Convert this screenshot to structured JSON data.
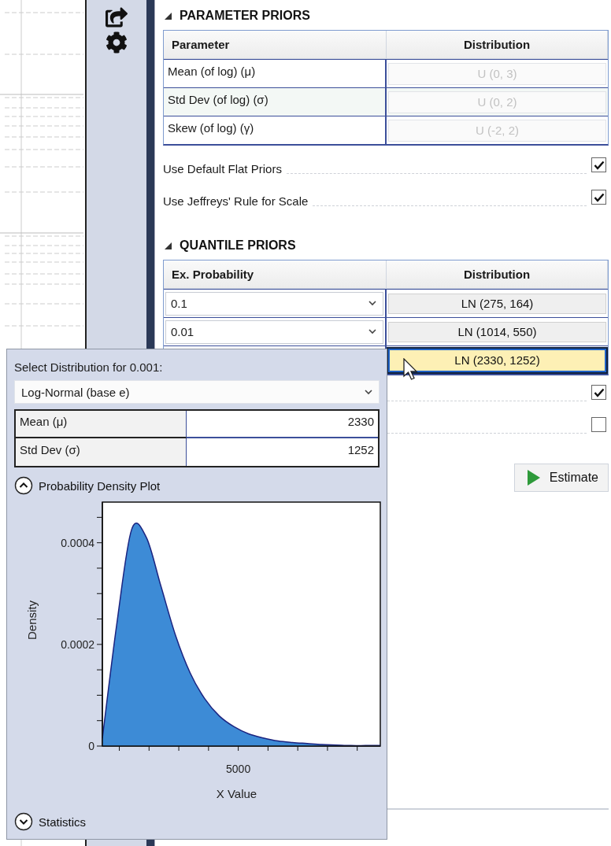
{
  "parameter_priors": {
    "title": "PARAMETER PRIORS",
    "expanded": true,
    "columns": [
      "Parameter",
      "Distribution"
    ],
    "rows": [
      {
        "parameter": "Mean (of log) (μ)",
        "distribution": "U (0, 3)",
        "disabled": true
      },
      {
        "parameter": "Std Dev (of log) (σ)",
        "distribution": "U (0, 2)",
        "disabled": true
      },
      {
        "parameter": "Skew (of log) (γ)",
        "distribution": "U (-2, 2)",
        "disabled": true
      }
    ]
  },
  "parameter_options": [
    {
      "label": "Use Default Flat Priors",
      "checked": true
    },
    {
      "label": "Use Jeffreys' Rule for Scale",
      "checked": true
    }
  ],
  "quantile_priors": {
    "title": "QUANTILE PRIORS",
    "expanded": true,
    "columns": [
      "Ex. Probability",
      "Distribution"
    ],
    "rows": [
      {
        "probability": "0.1",
        "distribution": "LN (275, 164)",
        "selected": false
      },
      {
        "probability": "0.01",
        "distribution": "LN (1014, 550)",
        "selected": false
      },
      {
        "distribution": "LN (2330, 1252)",
        "selected": true
      }
    ]
  },
  "quantile_options": [
    {
      "checked": true
    },
    {
      "checked": false
    }
  ],
  "estimate_button": {
    "label": "Estimate"
  },
  "distribution_popup": {
    "title": "Select Distribution for 0.001:",
    "distribution": "Log-Normal (base e)",
    "parameters": [
      {
        "name": "Mean (μ)",
        "value": "2330"
      },
      {
        "name": "Std Dev (σ)",
        "value": "1252"
      }
    ],
    "plot_section": {
      "title": "Probability Density Plot",
      "expanded": true,
      "chart_data": {
        "type": "area",
        "xlabel": "X Value",
        "ylabel": "Density",
        "ylim": [
          0,
          0.00048
        ],
        "yticks": [
          {
            "value": 0,
            "label": "0"
          },
          {
            "value": 0.0002,
            "label": "0.0002"
          },
          {
            "value": 0.0004,
            "label": "0.0004"
          }
        ],
        "annotations": [
          "5000"
        ],
        "series": [
          {
            "color": "#3d8bd6",
            "values": [
              1.5e-05,
              0.000243,
              0.000426,
              0.000411,
              0.000315,
              0.000218,
              0.000144,
              9.3e-05,
              5.9e-05,
              3.8e-05,
              2.4e-05,
              1.6e-05,
              1e-05,
              7e-06,
              5e-06,
              3e-06,
              2e-06,
              1e-06,
              1e-06,
              1e-06
            ]
          }
        ]
      }
    },
    "statistics_section": {
      "title": "Statistics",
      "expanded": false
    }
  }
}
